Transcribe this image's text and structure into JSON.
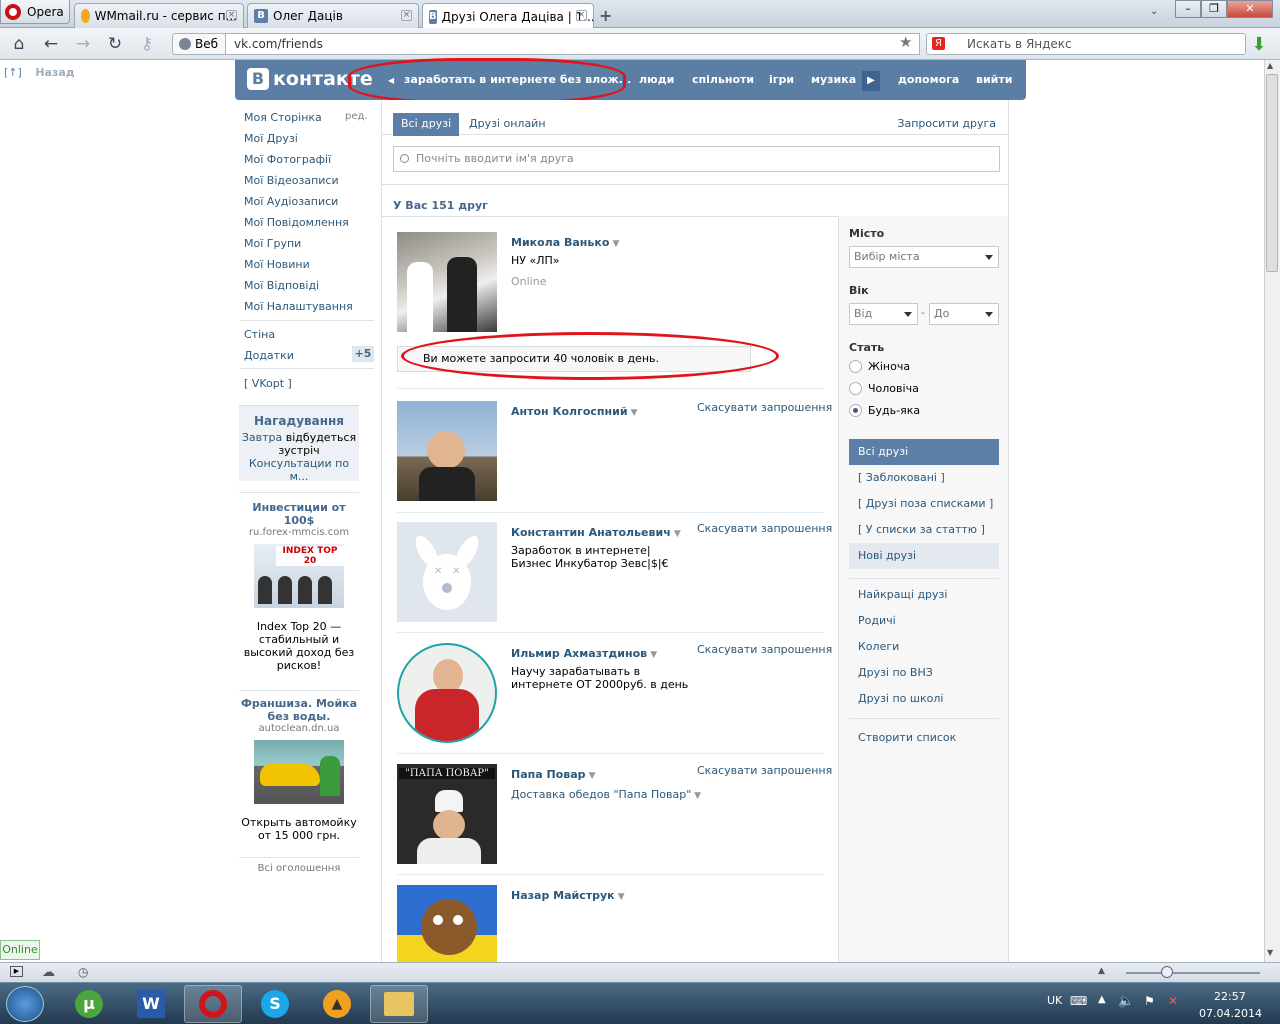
{
  "browser": {
    "menu_label": "Opera",
    "tabs": [
      {
        "title": "WMmail.ru - сервис п..."
      },
      {
        "title": "Олег Даців"
      },
      {
        "title": "Друзі Олега Даціва | 1..."
      }
    ],
    "web_button": "Веб",
    "url": "vk.com/friends",
    "search_placeholder": "Искать в Яндекс",
    "search_engine_icon": "Я"
  },
  "page": {
    "back_arrow": "[↑]",
    "back_label": "Назад",
    "logo_text": "контакте",
    "logo_letter": "В",
    "promo_link": "заработать в интернете без влож...",
    "top_nav": [
      "люди",
      "спільноти",
      "ігри",
      "музика",
      "допомога",
      "вийти"
    ],
    "left_menu": [
      "Моя Сторінка",
      "Мої Друзі",
      "Мої Фотографії",
      "Мої Відеозаписи",
      "Мої Аудіозаписи",
      "Мої Повідомлення",
      "Мої Групи",
      "Мої Новини",
      "Мої Відповіді",
      "Мої Налаштування"
    ],
    "edit_label": "ред.",
    "left_menu_extra": [
      "Стіна",
      "Додатки"
    ],
    "apps_badge": "+5",
    "vkopt_label": "[ VKopt ]",
    "reminder": {
      "title": "Нагадування",
      "link": "Завтра",
      "text": "відбудеться зустріч",
      "event": "Консультации по м..."
    },
    "ads": [
      {
        "title": "Инвестиции от 100$",
        "url": "ru.forex-mmcis.com",
        "img_label": "INDEX TOP 20",
        "text": "Index Top 20 — стабильный и высокий доход без рисков!"
      },
      {
        "title": "Франшиза. Мойка без воды.",
        "url": "autoclean.dn.ua",
        "text": "Открыть автомойку от 15 000 грн."
      }
    ],
    "all_ads_link": "Всі оголошення"
  },
  "friends": {
    "tab_all": "Всі друзі",
    "tab_online": "Друзі онлайн",
    "invite_link": "Запросити друга",
    "search_placeholder": "Почніть вводити ім'я друга",
    "count_text": "У Вас 151 друг",
    "notice": "Ви можете запросити 40 чоловік в день.",
    "list": [
      {
        "name": "Микола Ванько",
        "line2": "НУ «ЛП»",
        "line3": "Online",
        "action": ""
      },
      {
        "name": "Антон Колгоспний",
        "line2": "",
        "line3": "",
        "action": "Скасувати запрошення"
      },
      {
        "name": "Константин Анатольевич",
        "line2": "Заработок в интернете|Бизнес Инкубатор Зевс|$|€",
        "line3": "",
        "action": "Скасувати запрошення"
      },
      {
        "name": "Ильмир Ахмазтдинов",
        "line2": "Научу зарабатывать в интернете ОТ 2000руб. в день",
        "line3": "",
        "action": "Скасувати запрошення"
      },
      {
        "name": "Папа Повар",
        "line2": "Доставка обедов \"Папа Повар\"",
        "line3": "",
        "action": "Скасувати запрошення",
        "photo_caption": "\"ПАПА ПОВАР\""
      },
      {
        "name": "Назар Майструк",
        "line2": "",
        "line3": "",
        "action": ""
      }
    ]
  },
  "filters": {
    "city_label": "Місто",
    "city_select": "Вибір міста",
    "age_label": "Вік",
    "age_from": "Від",
    "age_dash": "-",
    "age_to": "До",
    "gender_label": "Стать",
    "gender_options": [
      "Жіноча",
      "Чоловіча",
      "Будь-яка"
    ],
    "gender_selected": "Будь-яка",
    "lists": [
      "Всі друзі",
      "[ Заблоковані ]",
      "[ Друзі поза списками ]",
      "[ У списки за статтю ]",
      "Нові друзі"
    ],
    "categories": [
      "Найкращі друзі",
      "Родичі",
      "Колеги",
      "Друзі по ВНЗ",
      "Друзі по школі"
    ],
    "create_list": "Створити список"
  },
  "statusbar": {
    "online_badge": "Online"
  },
  "taskbar": {
    "lang": "UK",
    "time": "22:57",
    "date": "07.04.2014"
  },
  "colors": {
    "vk_blue": "#5b7ea5",
    "link": "#2b587a",
    "annotation_red": "#e0141a"
  }
}
